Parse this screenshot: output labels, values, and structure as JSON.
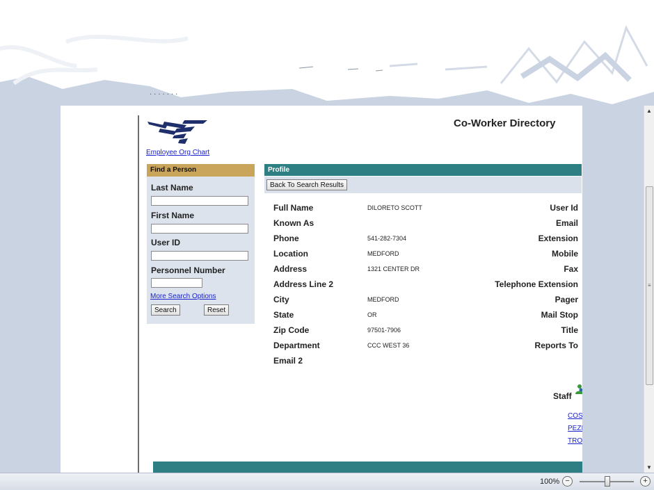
{
  "colors": {
    "page_bg": "#c9d3e2",
    "find_header": "#c9a55b",
    "profile_header": "#2e7f83",
    "panel_bg": "#dce3ed",
    "link": "#1a22cc",
    "logo_blue": "#1f2f6b"
  },
  "header": {
    "logo_icon": "company-logo",
    "org_chart_link": "Employee Org Chart",
    "app_title": "Co-Worker Directory"
  },
  "find_person": {
    "title": "Find a Person",
    "fields": [
      {
        "label": "Last Name",
        "value": ""
      },
      {
        "label": "First Name",
        "value": ""
      },
      {
        "label": "User ID",
        "value": ""
      },
      {
        "label": "Personnel Number",
        "value": ""
      }
    ],
    "more_options_link": "More Search Options",
    "search_button": "Search",
    "reset_button": "Reset"
  },
  "profile": {
    "title": "Profile",
    "back_button": "Back To Search Results",
    "left_rows": [
      {
        "label": "Full Name",
        "value": "DILORETO SCOTT"
      },
      {
        "label": "Known As",
        "value": ""
      },
      {
        "label": "Phone",
        "value": "541-282-7304"
      },
      {
        "label": "Location",
        "value": "MEDFORD"
      },
      {
        "label": "Address",
        "value": "1321 CENTER DR"
      },
      {
        "label": "Address Line 2",
        "value": ""
      },
      {
        "label": "City",
        "value": "MEDFORD"
      },
      {
        "label": "State",
        "value": "OR"
      },
      {
        "label": "Zip Code",
        "value": "97501-7906"
      },
      {
        "label": "Department",
        "value": "CCC WEST 36"
      },
      {
        "label": "Email 2",
        "value": ""
      }
    ],
    "right_labels": [
      "User Id",
      "Email",
      "Extension",
      "Mobile",
      "Fax",
      "Telephone Extension",
      "Pager",
      "Mail Stop",
      "Title",
      "Reports To"
    ],
    "staff": {
      "label": "Staff",
      "icon": "people-icon",
      "links": [
        "COS",
        "PEZI",
        "TROI"
      ]
    }
  },
  "statusbar": {
    "zoom": "100%",
    "zoom_minus": "−",
    "zoom_plus": "+"
  }
}
